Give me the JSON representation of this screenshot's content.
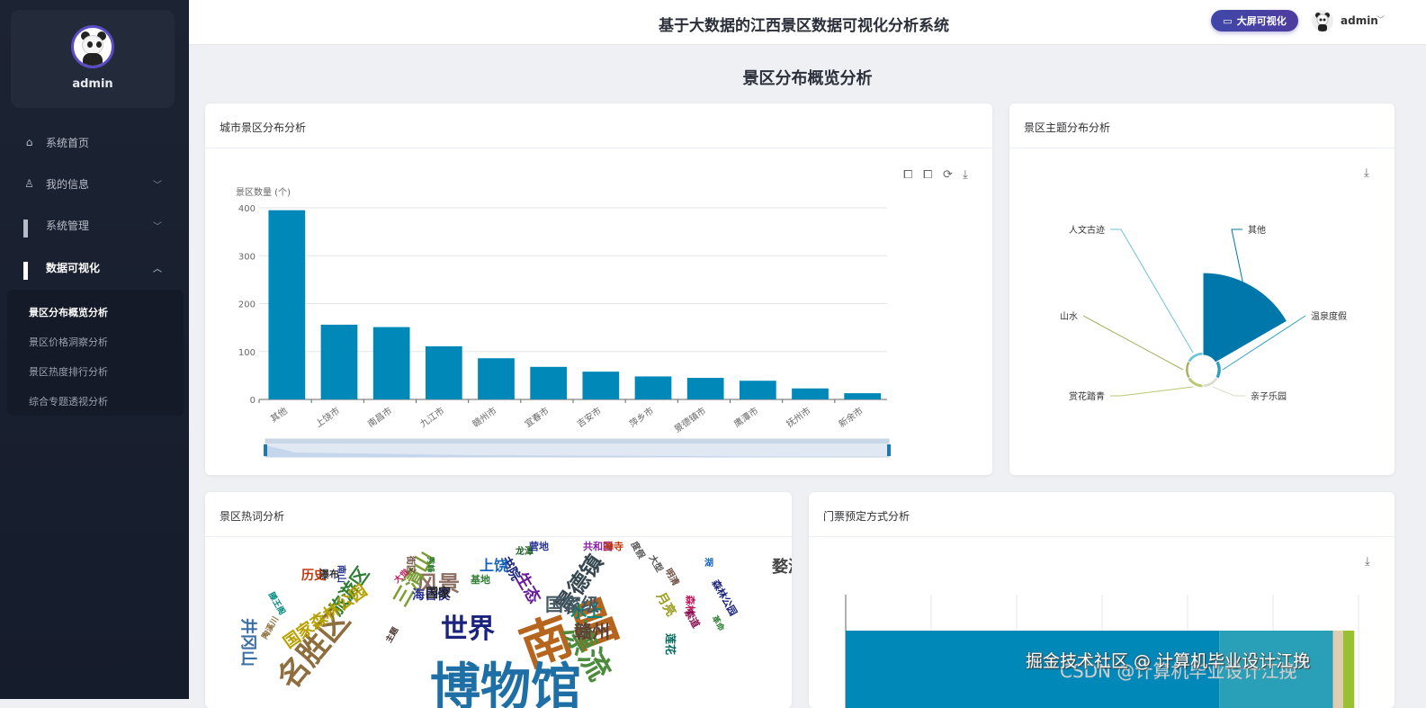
{
  "app": {
    "title": "基于大数据的江西景区数据可视化分析系统",
    "bigscreen_label": "大屏可视化",
    "user": "admin"
  },
  "sidebar": {
    "username": "admin",
    "items": [
      {
        "label": "系统首页",
        "icon": "home-icon"
      },
      {
        "label": "我的信息",
        "icon": "user-icon"
      },
      {
        "label": "系统管理",
        "icon": "grid-icon"
      },
      {
        "label": "数据可视化",
        "icon": "grid-icon"
      }
    ],
    "submenu": [
      {
        "label": "景区分布概览分析",
        "active": true
      },
      {
        "label": "景区价格洞察分析"
      },
      {
        "label": "景区热度排行分析"
      },
      {
        "label": "综合专题透视分析"
      }
    ]
  },
  "page": {
    "title": "景区分布概览分析"
  },
  "cards": {
    "city": "城市景区分布分析",
    "theme": "景区主题分布分析",
    "words": "景区热词分析",
    "ticket": "门票预定方式分析"
  },
  "chart_data": [
    {
      "type": "bar",
      "title": "城市景区分布分析",
      "ylabel": "景区数量 (个)",
      "ylim": [
        0,
        400
      ],
      "yticks": [
        0,
        100,
        200,
        300,
        400
      ],
      "categories": [
        "其他",
        "上饶市",
        "南昌市",
        "九江市",
        "赣州市",
        "宜春市",
        "吉安市",
        "萍乡市",
        "景德镇市",
        "鹰潭市",
        "抚州市",
        "新余市"
      ],
      "values": [
        395,
        156,
        151,
        111,
        86,
        68,
        58,
        48,
        45,
        39,
        23,
        13
      ],
      "color": "#0088b8"
    },
    {
      "type": "pie",
      "rose": true,
      "title": "景区主题分布分析",
      "categories": [
        "其他",
        "温泉度假",
        "亲子乐园",
        "赏花踏青",
        "山水",
        "人文古迹"
      ],
      "values": [
        400,
        6,
        3,
        4,
        2,
        3
      ],
      "colors": [
        "#0077aa",
        "#2aa0c0",
        "#d8dcc8",
        "#b8c870",
        "#a8b060",
        "#6cc4d8"
      ]
    },
    {
      "type": "bar",
      "orientation": "horizontal-stacked",
      "title": "门票预定方式分析",
      "xlim": [
        0,
        6
      ],
      "values": [
        4.37,
        1.33,
        0.12,
        0.13
      ],
      "colors": [
        "#0088b8",
        "#2aa0b8",
        "#e0ccb0",
        "#99c030"
      ]
    }
  ],
  "wordcloud": [
    "南昌",
    "博物馆",
    "漂流",
    "世界",
    "名胜区",
    "风景",
    "景德镇",
    "旅游区",
    "国家森林公园",
    "三清山",
    "井冈山",
    "婺源",
    "赣州",
    "水上",
    "生态",
    "国家级",
    "书院",
    "上饶",
    "海昏侯",
    "国家",
    "历史",
    "瀑布",
    "街区",
    "基地",
    "龙潭",
    "营地",
    "共和国",
    "禅寺",
    "度假",
    "大型",
    "明清",
    "月亮",
    "森林",
    "森林公园",
    "莲花",
    "索道",
    "革命",
    "大觉",
    "秀峰",
    "南山",
    "滕王阁",
    "陶溪川",
    "湖",
    "主题"
  ],
  "watermark": [
    "掘金技术社区 @ 计算机毕业设计江挽",
    "CSDN @计算机毕业设计江挽"
  ]
}
